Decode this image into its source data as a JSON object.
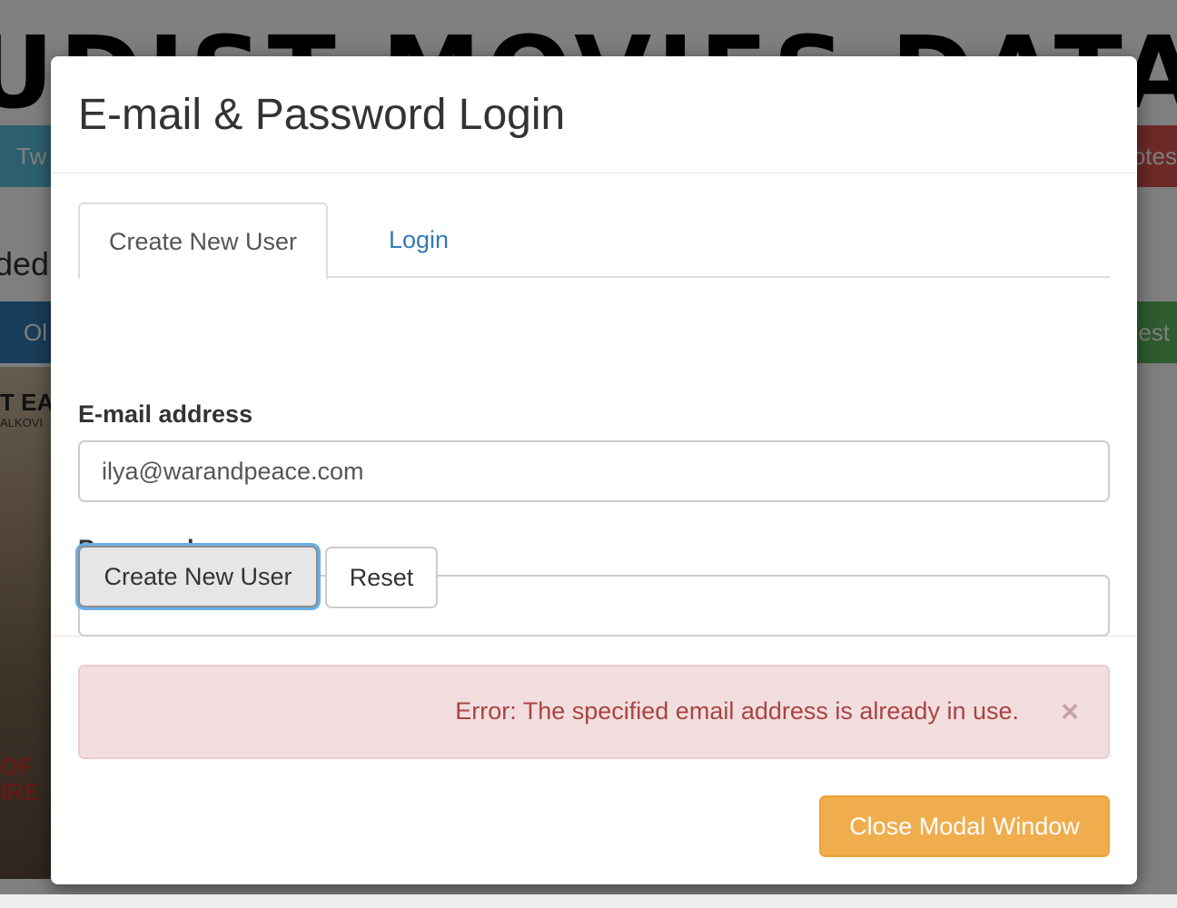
{
  "background": {
    "title_fragment": "UDIST MOVIES DATABA",
    "left_button_fragment": "Tw",
    "right_button_fragment": "otes",
    "heading_fragment": "ded",
    "left_button2_fragment": "Ol",
    "right_button2_fragment": "est",
    "poster_text1": "T EA",
    "poster_text2": "ALKOVI",
    "poster_text3": "OF\nIRE"
  },
  "modal": {
    "title": "E-mail & Password Login",
    "tabs": [
      {
        "label": "Create New User",
        "active": true
      },
      {
        "label": "Login",
        "active": false
      }
    ],
    "email": {
      "label": "E-mail address",
      "value": "ilya@warandpeace.com"
    },
    "password": {
      "label": "Password",
      "masked_value": "•••••••"
    },
    "buttons": {
      "create": "Create New User",
      "reset": "Reset"
    },
    "alert": {
      "message": "Error: The specified email address is already in use.",
      "close_glyph": "×"
    },
    "footer": {
      "close_label": "Close Modal Window"
    }
  },
  "colors": {
    "link": "#337ab7",
    "alert_bg": "#f2dede",
    "alert_text": "#a94442",
    "warning_button": "#f0ad4e",
    "focus_ring": "#66afe9"
  }
}
